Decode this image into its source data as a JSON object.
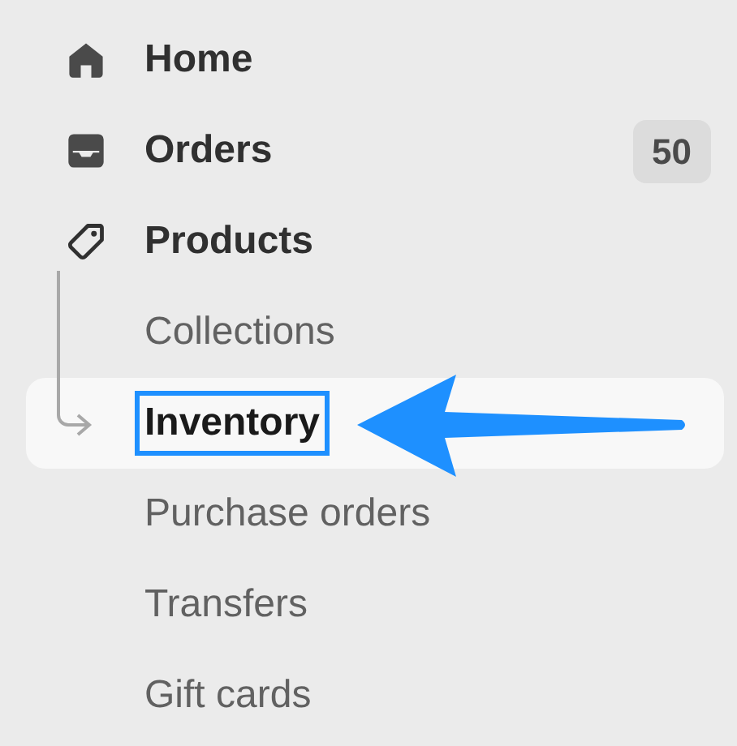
{
  "nav": [
    {
      "label": "Home",
      "kind": "top",
      "selected": false
    },
    {
      "label": "Orders",
      "kind": "top",
      "selected": false,
      "badge": "50"
    },
    {
      "label": "Products",
      "kind": "top",
      "selected": false
    },
    {
      "label": "Collections",
      "kind": "sub",
      "selected": false
    },
    {
      "label": "Inventory",
      "kind": "sub",
      "selected": true
    },
    {
      "label": "Purchase orders",
      "kind": "sub",
      "selected": false
    },
    {
      "label": "Transfers",
      "kind": "sub",
      "selected": false
    },
    {
      "label": "Gift cards",
      "kind": "sub",
      "selected": false
    }
  ],
  "annotation": {
    "kind": "arrow"
  }
}
